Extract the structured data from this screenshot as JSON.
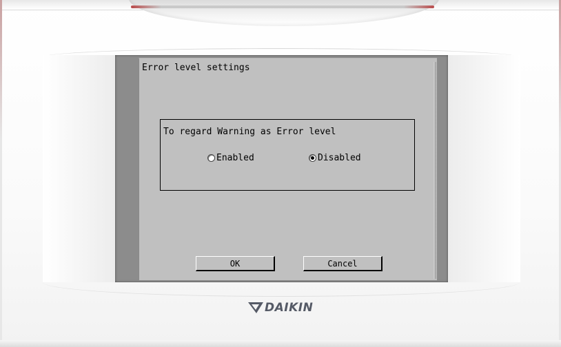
{
  "dialog": {
    "title": "Error level settings",
    "group_label": "To regard Warning as Error level",
    "options": [
      {
        "label": "Enabled",
        "selected": false
      },
      {
        "label": "Disabled",
        "selected": true
      }
    ],
    "ok_label": "OK",
    "cancel_label": "Cancel"
  },
  "brand": {
    "name": "DAIKIN",
    "logo_icon": "daikin-triangle-icon",
    "color": "#555a66"
  },
  "colors": {
    "screen_bg": "#c0c0c0",
    "bezel": "#8c8c8c",
    "accent_red": "#b94a4a"
  }
}
